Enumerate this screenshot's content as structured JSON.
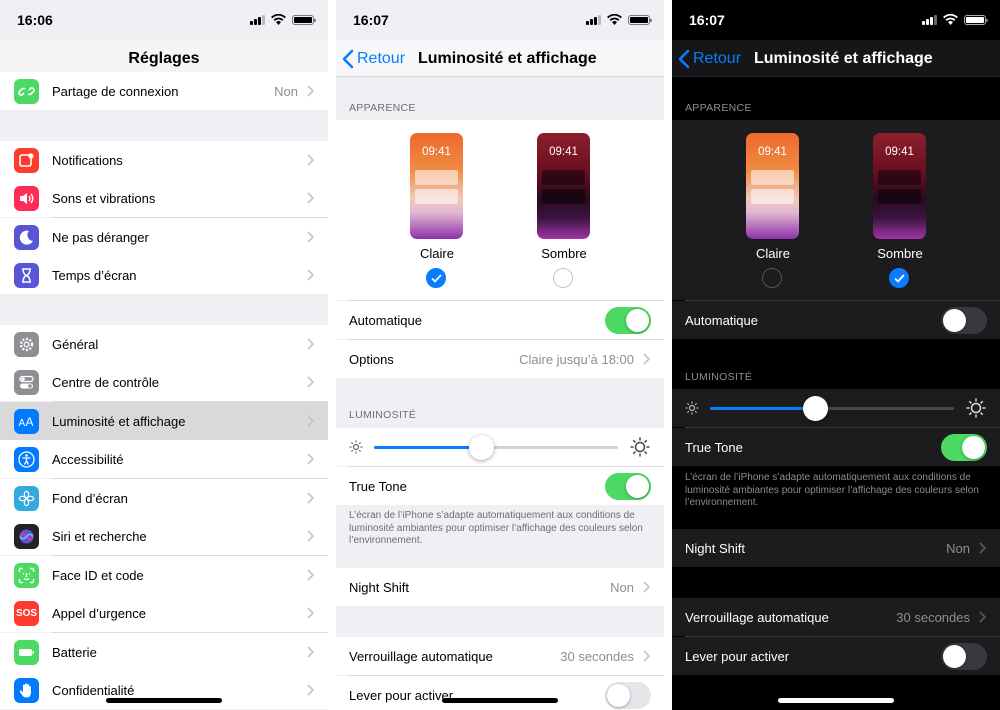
{
  "colors": {
    "accent": "#0a7cff",
    "toggle_on": "#4cd964"
  },
  "panels": {
    "settings": {
      "time": "16:06",
      "title": "Réglages",
      "items": [
        {
          "label": "Partage de connexion",
          "value": "Non",
          "icon": "chain-link-icon",
          "color": "#4cd964"
        },
        {
          "label": "Notifications",
          "icon": "notifications-icon",
          "color": "#ff3b30"
        },
        {
          "label": "Sons et vibrations",
          "icon": "speaker-icon",
          "color": "#ff2d55"
        },
        {
          "label": "Ne pas déranger",
          "icon": "moon-icon",
          "color": "#5856d6"
        },
        {
          "label": "Temps d’écran",
          "icon": "hourglass-icon",
          "color": "#5856d6"
        },
        {
          "label": "Général",
          "icon": "gear-icon",
          "color": "#8e8e93"
        },
        {
          "label": "Centre de contrôle",
          "icon": "switches-icon",
          "color": "#8e8e93"
        },
        {
          "label": "Luminosité et affichage",
          "icon": "text-size-icon",
          "color": "#007aff"
        },
        {
          "label": "Accessibilité",
          "icon": "accessibility-icon",
          "color": "#007aff"
        },
        {
          "label": "Fond d’écran",
          "icon": "flower-icon",
          "color": "#34aadc"
        },
        {
          "label": "Siri et recherche",
          "icon": "siri-icon",
          "color": "#222"
        },
        {
          "label": "Face ID et code",
          "icon": "face-id-icon",
          "color": "#4cd964"
        },
        {
          "label": "Appel d’urgence",
          "icon": "sos-icon",
          "icon_text": "SOS",
          "color": "#ff3b30"
        },
        {
          "label": "Batterie",
          "icon": "battery-icon",
          "color": "#4cd964"
        },
        {
          "label": "Confidentialité",
          "icon": "hand-icon",
          "color": "#007aff"
        }
      ]
    },
    "display_light": {
      "time": "16:07",
      "back": "Retour",
      "title": "Luminosité et affichage",
      "appearance_header": "APPARENCE",
      "phone_time": "09:41",
      "light_label": "Claire",
      "dark_label": "Sombre",
      "selected": "light",
      "automatic_label": "Automatique",
      "automatic_on": true,
      "options_label": "Options",
      "options_value": "Claire jusqu’à 18:00",
      "brightness_header": "LUMINOSITÉ",
      "brightness": 0.44,
      "true_tone_label": "True Tone",
      "true_tone_on": true,
      "true_tone_desc": "L’écran de l’iPhone s’adapte automatiquement aux conditions de luminosité ambiantes pour optimiser l’affichage des couleurs selon l’environnement.",
      "night_shift_label": "Night Shift",
      "night_shift_value": "Non",
      "auto_lock_label": "Verrouillage automatique",
      "auto_lock_value": "30 secondes",
      "raise_label": "Lever pour activer",
      "raise_on": false
    },
    "display_dark": {
      "time": "16:07",
      "back": "Retour",
      "title": "Luminosité et affichage",
      "appearance_header": "APPARENCE",
      "phone_time": "09:41",
      "light_label": "Claire",
      "dark_label": "Sombre",
      "selected": "dark",
      "automatic_label": "Automatique",
      "automatic_on": false,
      "brightness_header": "LUMINOSITÉ",
      "brightness": 0.43,
      "true_tone_label": "True Tone",
      "true_tone_on": true,
      "true_tone_desc": "L’écran de l’iPhone s’adapte automatiquement aux conditions de luminosité ambiantes pour optimiser l’affichage des couleurs selon l’environnement.",
      "night_shift_label": "Night Shift",
      "night_shift_value": "Non",
      "auto_lock_label": "Verrouillage automatique",
      "auto_lock_value": "30 secondes",
      "raise_label": "Lever pour activer",
      "raise_on": false
    }
  }
}
